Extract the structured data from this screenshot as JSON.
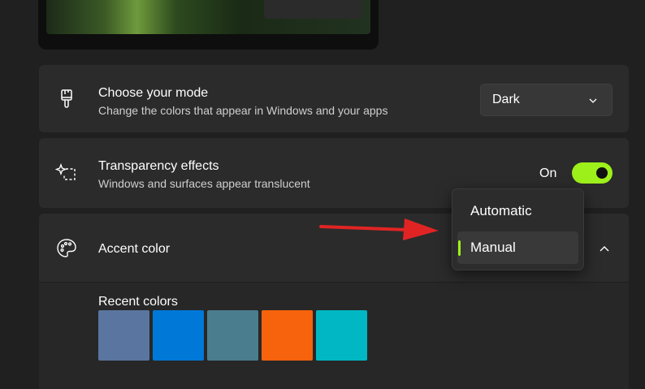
{
  "colors": {
    "accent": "#9ef01a",
    "background": "#202020",
    "card": "#2b2b2b",
    "annotation_arrow": "#e02424"
  },
  "mode": {
    "title": "Choose your mode",
    "subtitle": "Change the colors that appear in Windows and your apps",
    "icon": "paintbrush-icon",
    "selected": "Dark"
  },
  "transparency": {
    "title": "Transparency effects",
    "subtitle": "Windows and surfaces appear translucent",
    "icon": "sparkle-icon",
    "state_label": "On",
    "enabled": true
  },
  "accent": {
    "title": "Accent color",
    "icon": "palette-icon",
    "recent_label": "Recent colors",
    "recent_colors": [
      "#5a76a0",
      "#0078d7",
      "#4a7d8e",
      "#f7630c",
      "#00b7c3"
    ]
  },
  "accent_dropdown": {
    "options": [
      "Automatic",
      "Manual"
    ],
    "selected": "Manual"
  }
}
